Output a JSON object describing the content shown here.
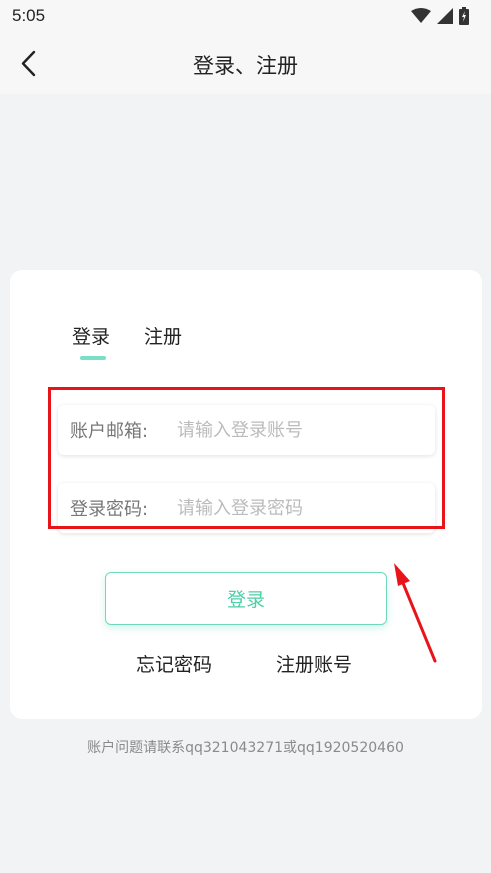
{
  "status_bar": {
    "time": "5:05",
    "icons": [
      "wifi-icon",
      "signal-icon",
      "battery-icon"
    ]
  },
  "nav": {
    "back_icon": "chevron-left-icon",
    "title": "登录、注册"
  },
  "tabs": {
    "login": "登录",
    "register": "注册",
    "active": "login",
    "indicator_color": "#78e0c5"
  },
  "form": {
    "email_label": "账户邮箱:",
    "email_placeholder": "请输入登录账号",
    "email_value": "",
    "password_label": "登录密码:",
    "password_placeholder": "请输入登录密码",
    "password_value": ""
  },
  "login_button": "登录",
  "links": {
    "forgot": "忘记密码",
    "signup": "注册账号"
  },
  "footer_note": "账户问题请联系qq321043271或qq1920520460",
  "colors": {
    "accent": "#4ecfa6",
    "highlight": "#e8141a",
    "background": "#f2f3f5"
  }
}
